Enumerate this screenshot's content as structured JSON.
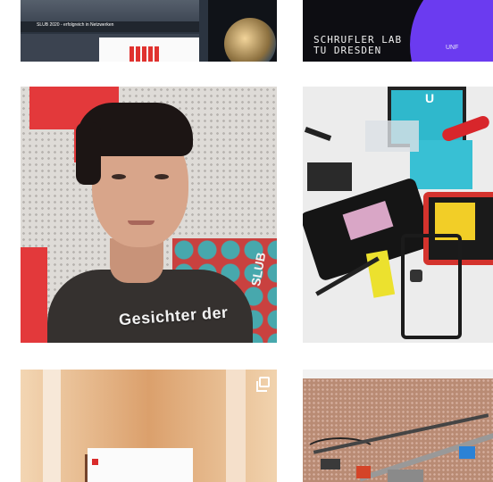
{
  "grid": {
    "tiles": [
      {
        "id": "post-1",
        "caption": "SLUB 2020 - erfolgreich in Netzwerken"
      },
      {
        "id": "post-2",
        "lines": [
          "SCHRUFLER LAB",
          "TU DRESDEN"
        ],
        "small_text": "UNF"
      },
      {
        "id": "post-3",
        "overlay_text": "Gesichter der",
        "overlay_text_2": "SLUB"
      },
      {
        "id": "post-4",
        "label": "U"
      },
      {
        "id": "post-5",
        "icon": "multiple-images-icon"
      },
      {
        "id": "post-6"
      }
    ]
  },
  "colors": {
    "background": "#ffffff",
    "slub_red": "#e3393b",
    "lab_purple": "#6b3bf0"
  }
}
